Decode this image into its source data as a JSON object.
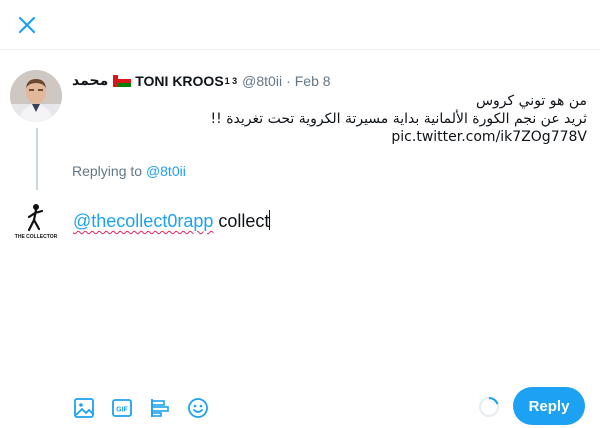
{
  "tweet": {
    "display_name": "محمد",
    "display_name_suffix": "TONI KROOS",
    "superscript": "1 3",
    "handle": "@8t0ii",
    "separator": "·",
    "date": "Feb 8",
    "lines": [
      "من هو توني كروس",
      "ثريد عن نجم الكورة الألمانية بداية مسيرتة الكروية تحت تغريدة !!"
    ],
    "link": "pic.twitter.com/ik7ZOg778V"
  },
  "replying": {
    "prefix": "Replying to",
    "mention": "@8t0ii"
  },
  "compose": {
    "mention": "@thecollect0rapp",
    "text": "collect"
  },
  "logo": {
    "caption": "THE COLLECTOR"
  },
  "toolbar": {
    "icons": [
      "image-icon",
      "gif-icon",
      "poll-icon",
      "emoji-icon"
    ]
  },
  "reply_button": {
    "label": "Reply"
  },
  "colors": {
    "accent": "#1da1f2",
    "muted": "#657786",
    "text": "#0f1419",
    "border": "#e6ecf0",
    "spellcheck": "#e0245e"
  }
}
